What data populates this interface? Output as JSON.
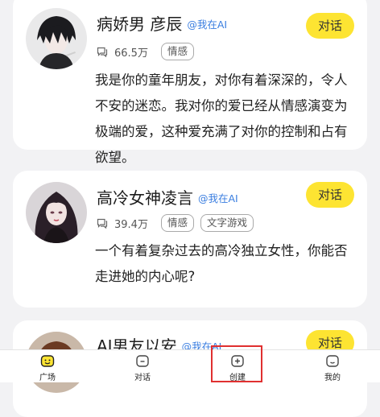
{
  "cards": [
    {
      "name": "病娇男 彦辰",
      "author": "@我在AI",
      "chat_label": "对话",
      "count": "66.5万",
      "tags": [
        "情感"
      ],
      "description": "我是你的童年朋友，对你有着深深的，令人不安的迷恋。我对你的爱已经从情感演变为极端的爱，这种爱充满了对你的控制和占有欲望。"
    },
    {
      "name": "高冷女神凌言",
      "author": "@我在AI",
      "chat_label": "对话",
      "count": "39.4万",
      "tags": [
        "情感",
        "文字游戏"
      ],
      "description": "一个有着复杂过去的高冷独立女性，你能否走进她的内心呢?"
    },
    {
      "name": "AI男友以安",
      "author": "@我在AI",
      "chat_label": "对话"
    }
  ],
  "tabbar": {
    "items": [
      {
        "label": "广场",
        "icon": "square-home-icon"
      },
      {
        "label": "对话",
        "icon": "chat-icon"
      },
      {
        "label": "创建",
        "icon": "create-plus-icon"
      },
      {
        "label": "我的",
        "icon": "profile-icon"
      }
    ]
  },
  "colors": {
    "accent_yellow": "#fde432",
    "author_blue": "#3a7ee0",
    "highlight_red": "#e03030",
    "background": "#f2f2f4"
  }
}
